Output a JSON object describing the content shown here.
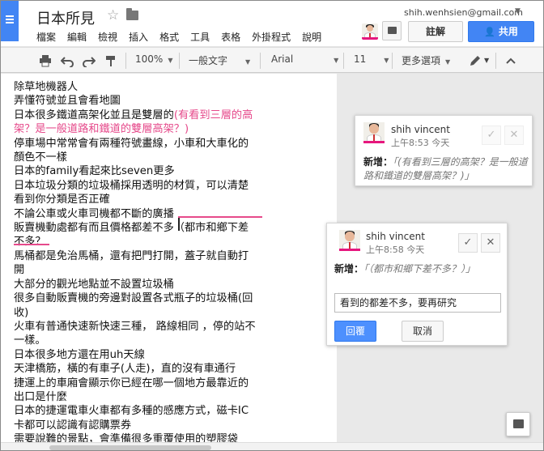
{
  "app": {
    "doc_title": "日本所見",
    "email": "shih.wenhsien@gmail.com",
    "menu": [
      "檔案",
      "編輯",
      "檢視",
      "插入",
      "格式",
      "工具",
      "表格",
      "外掛程式",
      "說明"
    ],
    "comments_label": "註解",
    "share_label": "共用"
  },
  "toolbar": {
    "zoom": "100%",
    "style": "一般文字",
    "font": "Arial",
    "size": "11",
    "more": "更多選項"
  },
  "document": {
    "lines": [
      "除草地機器人",
      "弄懂符號並且會看地圖",
      "日本很多鐵道高架化並且是雙層的",
      "停車場中常常會有兩種符號畫線，小車和大車化的",
      "顏色不一樣",
      "日本的family看起來比seven更多",
      "日本垃圾分類的垃圾桶採用透明的材質，可以清楚",
      "看到你分類是否正確",
      "不論公車或火車司機都不斷的廣播",
      "販賣機動處都有而且價格都差不多",
      "不多？",
      "馬桶都是免治馬桶，還有把門打開，蓋子就自動打",
      "開",
      "大部分的觀光地點並不設置垃圾桶",
      "很多自動販賣機的旁邊對設置各式瓶子的垃圾桶(回",
      "收)",
      "火車有普通快速新快速三種， 路線相同 ，停的站不",
      "一樣。",
      "日本很多地方還在用uh天線",
      "天津橋筋，橫的有車子(人走)，直的沒有車通行",
      "捷運上的車廂會顯示你已經在哪一個地方最靠近的",
      "出口是什麼",
      "日本的捷運電車火車都有多種的感應方式，磁卡IC",
      "卡都可以認識有認購票券",
      "需要說難的景點，會準備很多重覆使用的塑膠袋",
      "------------------------------------------"
    ],
    "pink_1": "(有看到三層的高",
    "pink_2": "架？是一般道路和鐵道的雙層高架？)",
    "bracket_2": "（都市和鄉下差"
  },
  "comments": [
    {
      "author": "shih vincent",
      "time": "上午8:53 今天",
      "label": "新增：",
      "quote": "「(有看到三層的高架？是一般道路和鐵道的雙層高架？)」"
    },
    {
      "author": "shih vincent",
      "time": "上午8:58 今天",
      "label": "新增：",
      "quote": "「（都市和鄉下差不多？）」",
      "reply_value": "看到的都差不多，要再研究",
      "reply_label": "回覆",
      "cancel_label": "取消"
    }
  ],
  "icons": [
    "docs-logo-icon",
    "star-icon",
    "folder-icon",
    "chat-icon",
    "print-icon",
    "undo-icon",
    "redo-icon",
    "paint-format-icon",
    "pen-icon",
    "collapse-icon",
    "check-icon",
    "close-icon",
    "comment-bubble-icon"
  ],
  "colors": {
    "accent": "#4285f4",
    "suggestion_pink": "#e64a8b",
    "avatar_bar": "#e6177e"
  }
}
